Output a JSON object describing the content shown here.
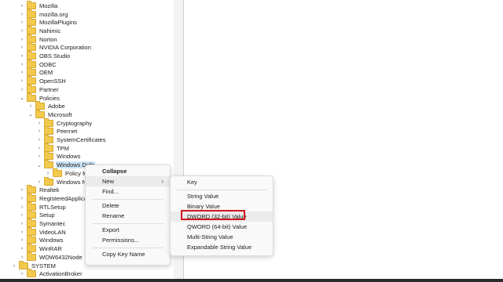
{
  "tree": {
    "items": [
      {
        "label": "Mozilla",
        "indent": 0,
        "expanded": false
      },
      {
        "label": "mozilla.org",
        "indent": 0,
        "expanded": false
      },
      {
        "label": "MozillaPlugins",
        "indent": 0,
        "expanded": false
      },
      {
        "label": "Nahimic",
        "indent": 0,
        "expanded": false
      },
      {
        "label": "Norton",
        "indent": 0,
        "expanded": false
      },
      {
        "label": "NVIDIA Corporation",
        "indent": 0,
        "expanded": false
      },
      {
        "label": "OBS Studio",
        "indent": 0,
        "expanded": false
      },
      {
        "label": "ODBC",
        "indent": 0,
        "expanded": false
      },
      {
        "label": "OEM",
        "indent": 0,
        "expanded": false
      },
      {
        "label": "OpenSSH",
        "indent": 0,
        "expanded": false
      },
      {
        "label": "Partner",
        "indent": 0,
        "expanded": false
      },
      {
        "label": "Policies",
        "indent": 0,
        "expanded": true
      },
      {
        "label": "Adobe",
        "indent": 1,
        "expanded": false
      },
      {
        "label": "Microsoft",
        "indent": 1,
        "expanded": true
      },
      {
        "label": "Cryptography",
        "indent": 2,
        "expanded": false
      },
      {
        "label": "Peernet",
        "indent": 2,
        "expanded": false
      },
      {
        "label": "SystemCertificates",
        "indent": 2,
        "expanded": false
      },
      {
        "label": "TPM",
        "indent": 2,
        "expanded": false
      },
      {
        "label": "Windows",
        "indent": 2,
        "expanded": false
      },
      {
        "label": "Windows Defe",
        "indent": 2,
        "expanded": true,
        "selected": true
      },
      {
        "label": "Policy Mar",
        "indent": 3,
        "expanded": false
      },
      {
        "label": "Windows NT",
        "indent": 2,
        "expanded": false
      },
      {
        "label": "Realtek",
        "indent": 0,
        "expanded": false
      },
      {
        "label": "RegisteredApplicatio",
        "indent": 0,
        "expanded": false
      },
      {
        "label": "RTLSetup",
        "indent": 0,
        "expanded": false
      },
      {
        "label": "Setup",
        "indent": 0,
        "expanded": false
      },
      {
        "label": "Symantec",
        "indent": 0,
        "expanded": false
      },
      {
        "label": "VideoLAN",
        "indent": 0,
        "expanded": false
      },
      {
        "label": "Windows",
        "indent": 0,
        "expanded": false
      },
      {
        "label": "WinRAR",
        "indent": 0,
        "expanded": false
      },
      {
        "label": "WOW6432Node",
        "indent": 0,
        "expanded": false
      },
      {
        "label": "SYSTEM",
        "indent": -1,
        "expanded": false
      },
      {
        "label": "ActivationBroker",
        "indent": 0,
        "expanded": false
      }
    ]
  },
  "context_menu": {
    "items": [
      {
        "label": "Collapse",
        "bold": true
      },
      {
        "label": "New",
        "submenu": true,
        "hover": true
      },
      {
        "label": "Find..."
      },
      {
        "separator": true
      },
      {
        "label": "Delete"
      },
      {
        "label": "Rename"
      },
      {
        "separator": true
      },
      {
        "label": "Export"
      },
      {
        "label": "Permissions..."
      },
      {
        "separator": true
      },
      {
        "label": "Copy Key Name"
      }
    ]
  },
  "submenu": {
    "items": [
      {
        "label": "Key"
      },
      {
        "separator": true
      },
      {
        "label": "String Value"
      },
      {
        "label": "Binary Value"
      },
      {
        "label": "DWORD (32-bit) Value",
        "hover": true,
        "highlighted": true
      },
      {
        "label": "QWORD (64-bit) Value"
      },
      {
        "label": "Multi-String Value"
      },
      {
        "label": "Expandable String Value"
      }
    ]
  },
  "colors": {
    "selection": "#cce4f7",
    "highlight_border": "#d0161c",
    "folder": "#f2c94c"
  }
}
